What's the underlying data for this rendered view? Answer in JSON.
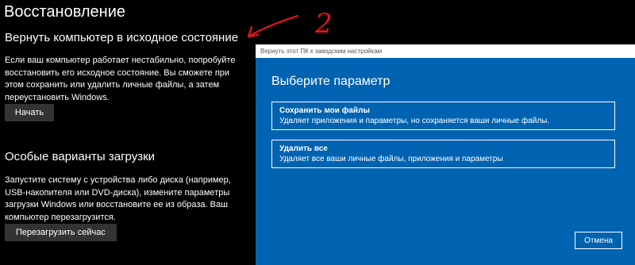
{
  "settings": {
    "page_title": "Восстановление",
    "reset": {
      "title": "Вернуть компьютер в исходное состояние",
      "description": "Если ваш компьютер работает нестабильно, попробуйте восстановить его исходное состояние. Вы сможете при этом сохранить или удалить личные файлы, а затем переустановить Windows.",
      "button": "Начать"
    },
    "advanced": {
      "title": "Особые варианты загрузки",
      "description": "Запустите систему с устройства либо диска (например, USB-накопителя или DVD-диска), измените параметры загрузки Windows или восстановите ее из образа. Ваш компьютер перезагрузится.",
      "button": "Перезагрузить сейчас"
    }
  },
  "annotation": {
    "text": "2",
    "color": "#e8141c"
  },
  "dialog": {
    "window_title": "Вернуть этот ПК к заводским настройкам",
    "heading": "Выберите параметр",
    "options": [
      {
        "title": "Сохранить мои файлы",
        "description": "Удаляет приложения и параметры, но сохраняется ваши личные файлы."
      },
      {
        "title": "Удалить все",
        "description": "Удаляет все ваши личные файлы, приложения и параметры"
      }
    ],
    "cancel": "Отмена",
    "background_color": "#0063b1"
  }
}
